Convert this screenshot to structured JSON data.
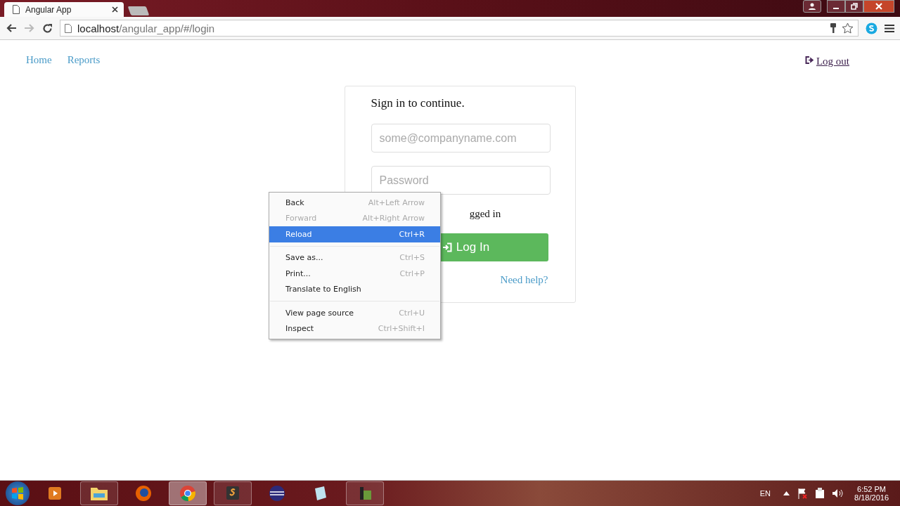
{
  "browser": {
    "tab_title": "Angular App",
    "url_host": "localhost",
    "url_path": "/angular_app/#/login"
  },
  "nav": {
    "links": [
      "Home",
      "Reports"
    ],
    "logout": "Log out"
  },
  "login": {
    "title": "Sign in to continue.",
    "email_placeholder": "some@companyname.com",
    "password_placeholder": "Password",
    "remember_label": "gged in",
    "submit": "Log In",
    "help": "Need help?"
  },
  "context_menu": [
    {
      "kind": "item",
      "label": "Back",
      "shortcut": "Alt+Left Arrow",
      "disabled": false,
      "selected": false
    },
    {
      "kind": "item",
      "label": "Forward",
      "shortcut": "Alt+Right Arrow",
      "disabled": true,
      "selected": false
    },
    {
      "kind": "item",
      "label": "Reload",
      "shortcut": "Ctrl+R",
      "disabled": false,
      "selected": true
    },
    {
      "kind": "separator"
    },
    {
      "kind": "item",
      "label": "Save as...",
      "shortcut": "Ctrl+S",
      "disabled": false,
      "selected": false
    },
    {
      "kind": "item",
      "label": "Print...",
      "shortcut": "Ctrl+P",
      "disabled": false,
      "selected": false
    },
    {
      "kind": "item",
      "label": "Translate to English",
      "disabled": false,
      "selected": false
    },
    {
      "kind": "separator"
    },
    {
      "kind": "item",
      "label": "View page source",
      "shortcut": "Ctrl+U",
      "disabled": false,
      "selected": false
    },
    {
      "kind": "item",
      "label": "Inspect",
      "shortcut": "Ctrl+Shift+I",
      "disabled": false,
      "selected": false
    }
  ],
  "taskbar": {
    "language": "EN",
    "time": "6:52 PM",
    "date": "8/18/2016"
  }
}
